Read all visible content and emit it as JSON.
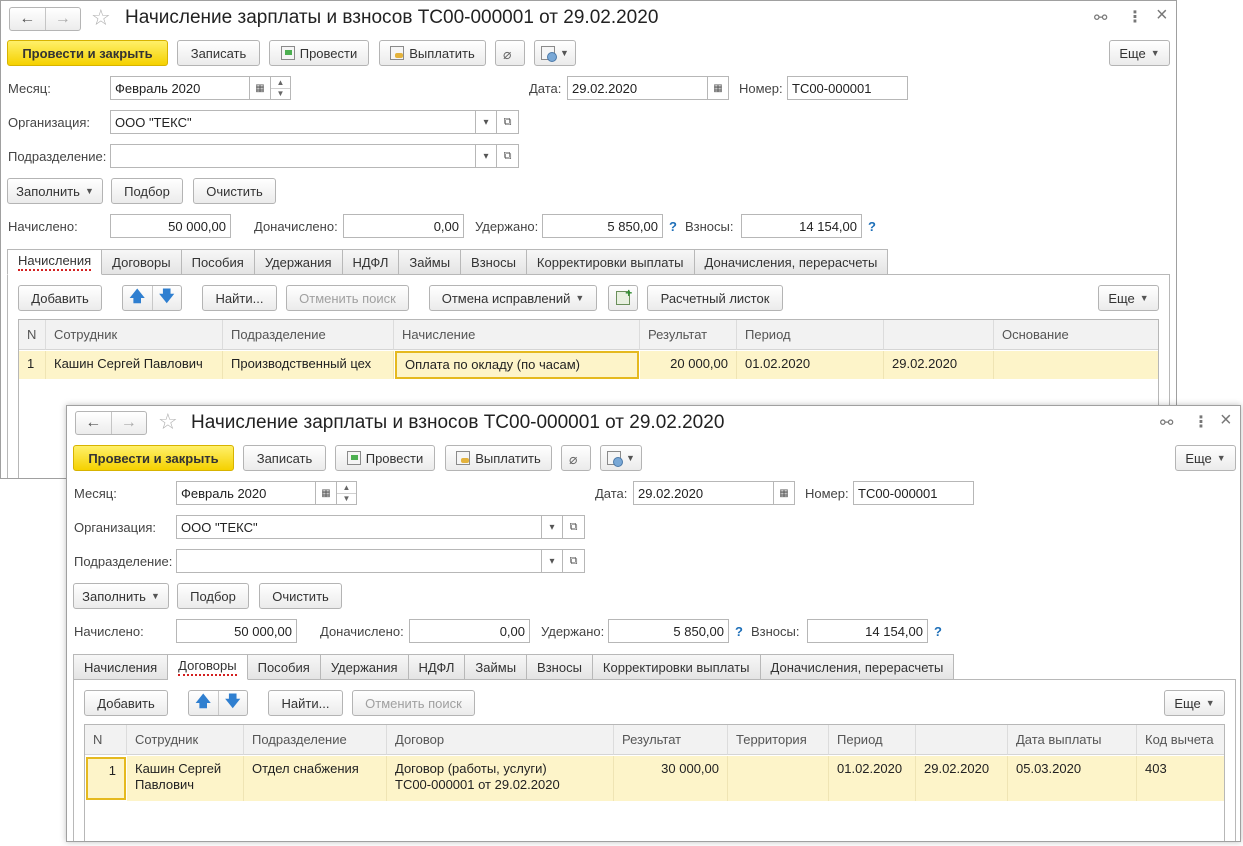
{
  "windows": [
    {
      "title": "Начисление зарплаты и взносов ТС00-000001 от 29.02.2020",
      "toolbar": {
        "post_close": "Провести и закрыть",
        "save": "Записать",
        "post": "Провести",
        "pay": "Выплатить",
        "more": "Еще"
      },
      "fields": {
        "month_label": "Месяц:",
        "month_value": "Февраль 2020",
        "date_label": "Дата:",
        "date_value": "29.02.2020",
        "number_label": "Номер:",
        "number_value": "ТС00-000001",
        "org_label": "Организация:",
        "org_value": "ООО \"ТЕКС\"",
        "dept_label": "Подразделение:",
        "dept_value": ""
      },
      "actions": {
        "fill": "Заполнить",
        "select": "Подбор",
        "clear": "Очистить"
      },
      "totals": {
        "accrued_label": "Начислено:",
        "accrued": "50 000,00",
        "extra_label": "Доначислено:",
        "extra": "0,00",
        "withheld_label": "Удержано:",
        "withheld": "5 850,00",
        "contrib_label": "Взносы:",
        "contrib": "14 154,00"
      },
      "tabs": [
        "Начисления",
        "Договоры",
        "Пособия",
        "Удержания",
        "НДФЛ",
        "Займы",
        "Взносы",
        "Корректировки выплаты",
        "Доначисления, перерасчеты"
      ],
      "active_tab": "Начисления",
      "table_toolbar": {
        "add": "Добавить",
        "find": "Найти...",
        "cancel_search": "Отменить поиск",
        "undo_corrections": "Отмена исправлений",
        "payslip": "Расчетный листок",
        "more": "Еще"
      },
      "table": {
        "columns": [
          "N",
          "Сотрудник",
          "Подразделение",
          "Начисление",
          "Результат",
          "Период",
          "",
          "Основание"
        ],
        "rows": [
          [
            "1",
            "Кашин Сергей Павлович",
            "Производственный цех",
            "Оплата по окладу (по часам)",
            "20 000,00",
            "01.02.2020",
            "29.02.2020",
            ""
          ]
        ]
      }
    },
    {
      "title": "Начисление зарплаты и взносов ТС00-000001 от 29.02.2020",
      "toolbar": {
        "post_close": "Провести и закрыть",
        "save": "Записать",
        "post": "Провести",
        "pay": "Выплатить",
        "more": "Еще"
      },
      "fields": {
        "month_label": "Месяц:",
        "month_value": "Февраль 2020",
        "date_label": "Дата:",
        "date_value": "29.02.2020",
        "number_label": "Номер:",
        "number_value": "ТС00-000001",
        "org_label": "Организация:",
        "org_value": "ООО \"ТЕКС\"",
        "dept_label": "Подразделение:",
        "dept_value": ""
      },
      "actions": {
        "fill": "Заполнить",
        "select": "Подбор",
        "clear": "Очистить"
      },
      "totals": {
        "accrued_label": "Начислено:",
        "accrued": "50 000,00",
        "extra_label": "Доначислено:",
        "extra": "0,00",
        "withheld_label": "Удержано:",
        "withheld": "5 850,00",
        "contrib_label": "Взносы:",
        "contrib": "14 154,00"
      },
      "tabs": [
        "Начисления",
        "Договоры",
        "Пособия",
        "Удержания",
        "НДФЛ",
        "Займы",
        "Взносы",
        "Корректировки выплаты",
        "Доначисления, перерасчеты"
      ],
      "active_tab": "Договоры",
      "table_toolbar": {
        "add": "Добавить",
        "find": "Найти...",
        "cancel_search": "Отменить поиск",
        "more": "Еще"
      },
      "table": {
        "columns": [
          "N",
          "Сотрудник",
          "Подразделение",
          "Договор",
          "Результат",
          "Территория",
          "Период",
          "",
          "Дата выплаты",
          "Код вычета"
        ],
        "rows": [
          [
            "1",
            "Кашин Сергей\nПавлович",
            "Отдел снабжения",
            "Договор (работы, услуги)\nТС00-000001 от 29.02.2020",
            "30 000,00",
            "",
            "01.02.2020",
            "29.02.2020",
            "05.03.2020",
            "403"
          ]
        ]
      }
    }
  ],
  "icons": {
    "back": "←",
    "forward": "→",
    "star": "☆",
    "link": "🔗",
    "menu": "⋮",
    "close": "×",
    "attach": "📎",
    "calendar": "▦",
    "dropdown": "▾",
    "open": "⧉",
    "up": "🡅",
    "down": "🡇",
    "help": "?"
  }
}
